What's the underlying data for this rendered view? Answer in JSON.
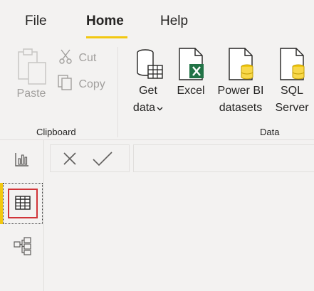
{
  "menu": {
    "tabs": [
      {
        "label": "File"
      },
      {
        "label": "Home",
        "active": true
      },
      {
        "label": "Help"
      }
    ],
    "active_underline_color": "#f2c811"
  },
  "ribbon": {
    "clipboard": {
      "group_label": "Clipboard",
      "paste_label": "Paste",
      "cut_label": "Cut",
      "copy_label": "Copy"
    },
    "data": {
      "group_label": "Data",
      "get_data": {
        "line1": "Get",
        "line2": "data",
        "chevron": "chevron-down-icon"
      },
      "excel_label": "Excel",
      "powerbi": {
        "line1": "Power BI",
        "line2": "datasets"
      },
      "sql": {
        "line1": "SQL",
        "line2": "Server"
      }
    }
  },
  "left_nav": {
    "items": [
      {
        "icon": "report-view-icon"
      },
      {
        "icon": "data-view-icon",
        "active": true
      },
      {
        "icon": "model-view-icon"
      }
    ],
    "accent": "#f2c811",
    "highlight": "#d13438"
  },
  "formula_bar": {
    "cancel_icon": "close-icon",
    "commit_icon": "checkmark-icon",
    "value": ""
  }
}
